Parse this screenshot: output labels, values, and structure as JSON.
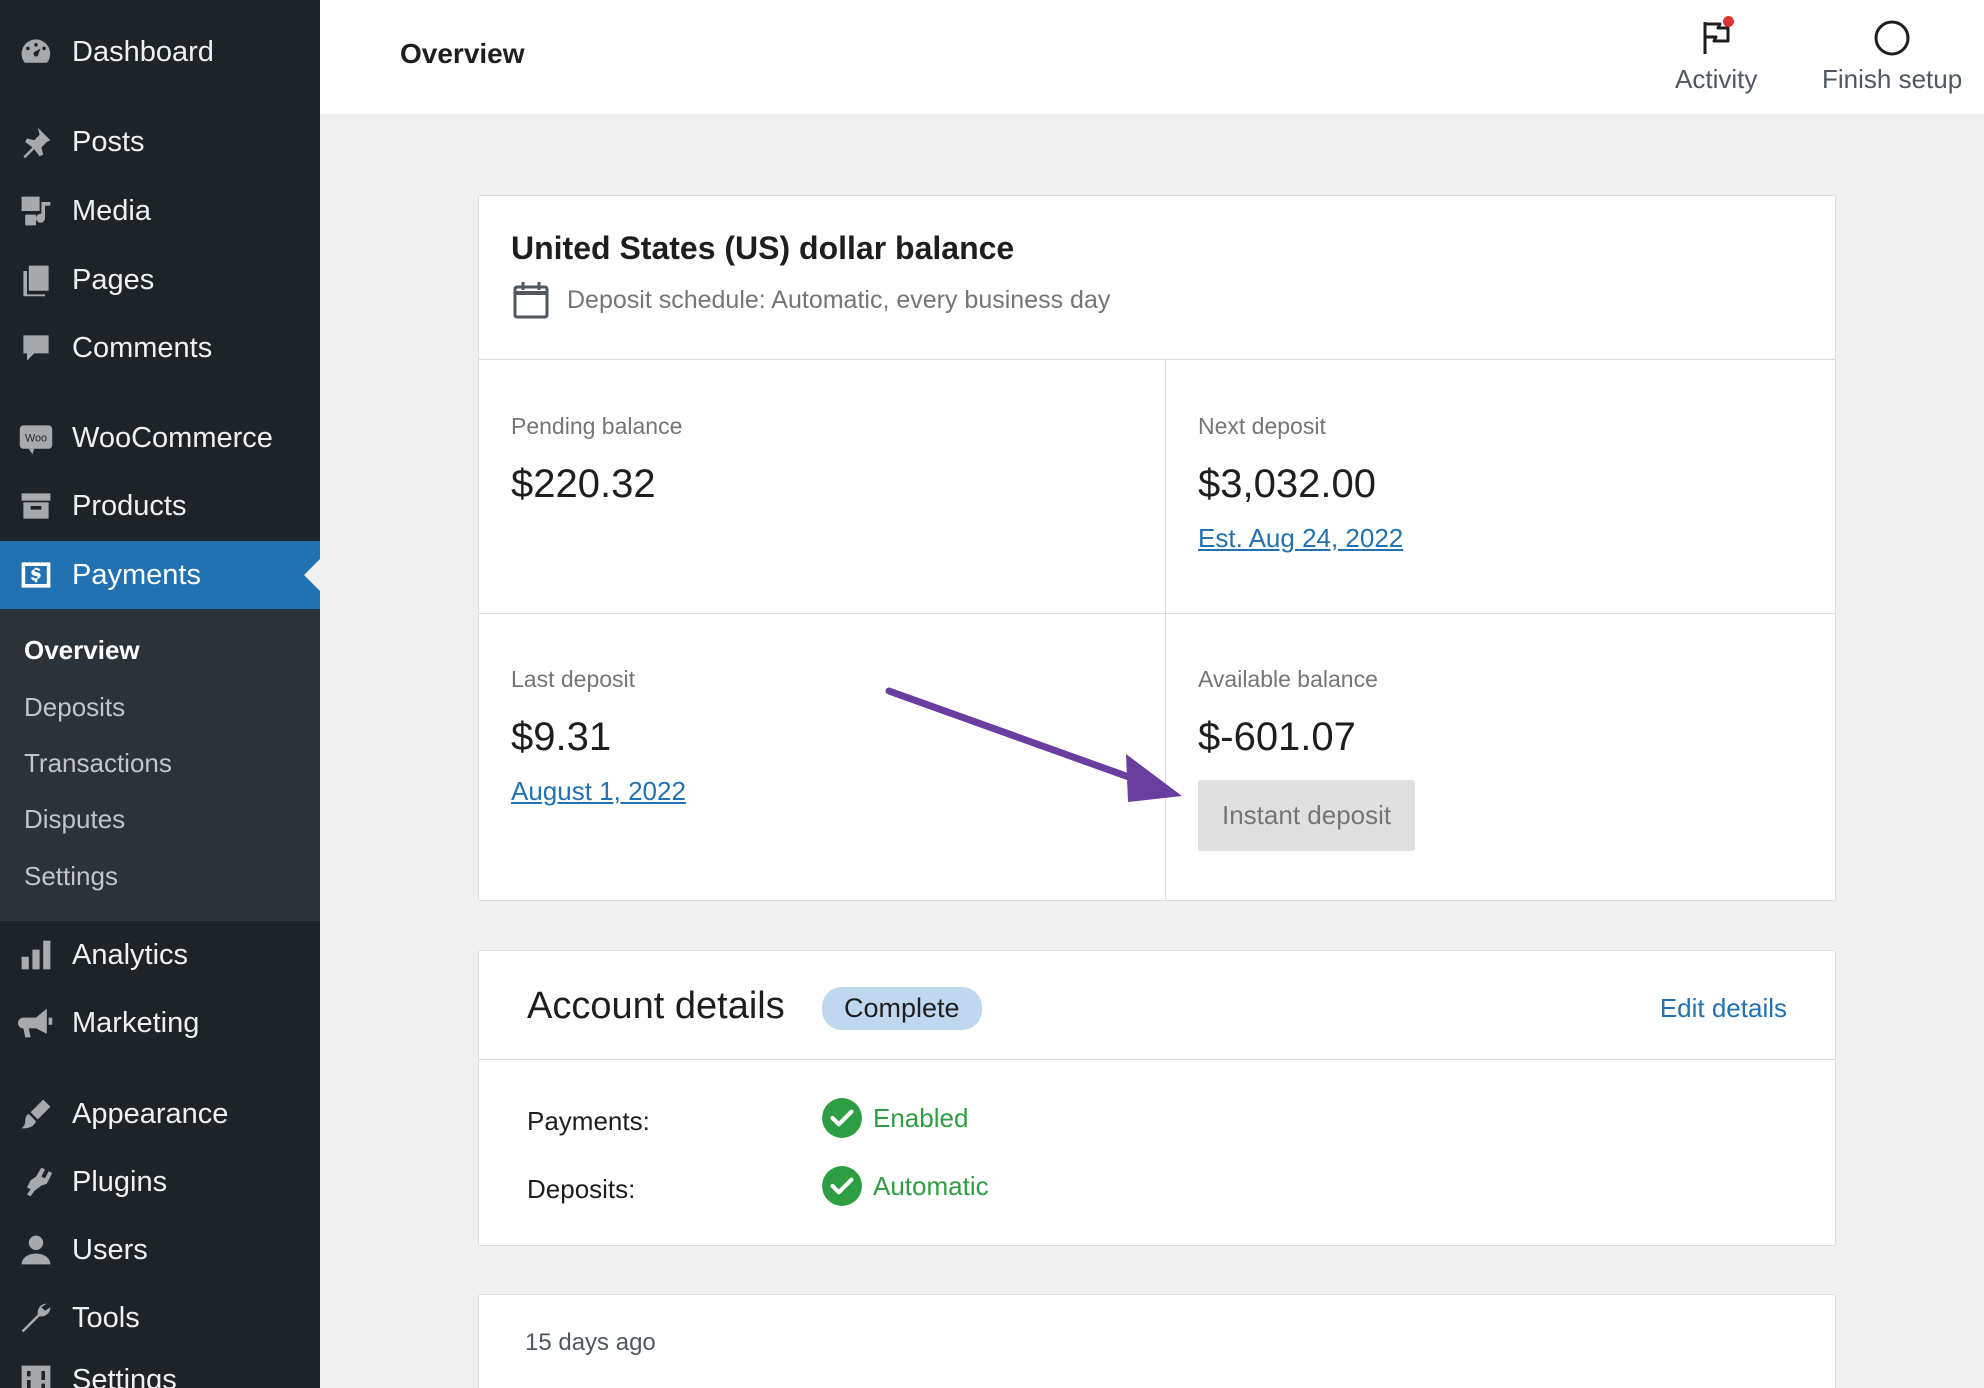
{
  "sidebar": {
    "items": [
      {
        "label": "Dashboard",
        "icon": "dashboard-icon"
      },
      {
        "label": "Posts",
        "icon": "pin-icon"
      },
      {
        "label": "Media",
        "icon": "media-icon"
      },
      {
        "label": "Pages",
        "icon": "pages-icon"
      },
      {
        "label": "Comments",
        "icon": "comment-icon"
      },
      {
        "label": "WooCommerce",
        "icon": "woo-icon"
      },
      {
        "label": "Products",
        "icon": "archive-icon"
      },
      {
        "label": "Payments",
        "icon": "payments-icon"
      },
      {
        "label": "Analytics",
        "icon": "bar-chart-icon"
      },
      {
        "label": "Marketing",
        "icon": "megaphone-icon"
      },
      {
        "label": "Appearance",
        "icon": "brush-icon"
      },
      {
        "label": "Plugins",
        "icon": "plugin-icon"
      },
      {
        "label": "Users",
        "icon": "user-icon"
      },
      {
        "label": "Tools",
        "icon": "wrench-icon"
      },
      {
        "label": "Settings",
        "icon": "settings-icon"
      }
    ],
    "submenu": [
      "Overview",
      "Deposits",
      "Transactions",
      "Disputes",
      "Settings"
    ]
  },
  "header": {
    "title": "Overview",
    "activity": "Activity",
    "finish_setup": "Finish setup"
  },
  "balance": {
    "title": "United States (US) dollar balance",
    "schedule": "Deposit schedule: Automatic, every business day",
    "pending_label": "Pending balance",
    "pending_value": "$220.32",
    "next_label": "Next deposit",
    "next_value": "$3,032.00",
    "next_link": "Est. Aug 24, 2022",
    "last_label": "Last deposit",
    "last_value": "$9.31",
    "last_link": "August 1, 2022",
    "available_label": "Available balance",
    "available_value": "$-601.07",
    "instant_button": "Instant deposit"
  },
  "account": {
    "title": "Account details",
    "badge": "Complete",
    "edit": "Edit details",
    "payments_label": "Payments:",
    "payments_value": "Enabled",
    "deposits_label": "Deposits:",
    "deposits_value": "Automatic"
  },
  "activity_card": {
    "ago": "15 days ago"
  },
  "colors": {
    "sidebar": "#1d2327",
    "accent": "#2271b1",
    "success": "#2e9e43",
    "annotation_arrow": "#6a3ea1"
  }
}
